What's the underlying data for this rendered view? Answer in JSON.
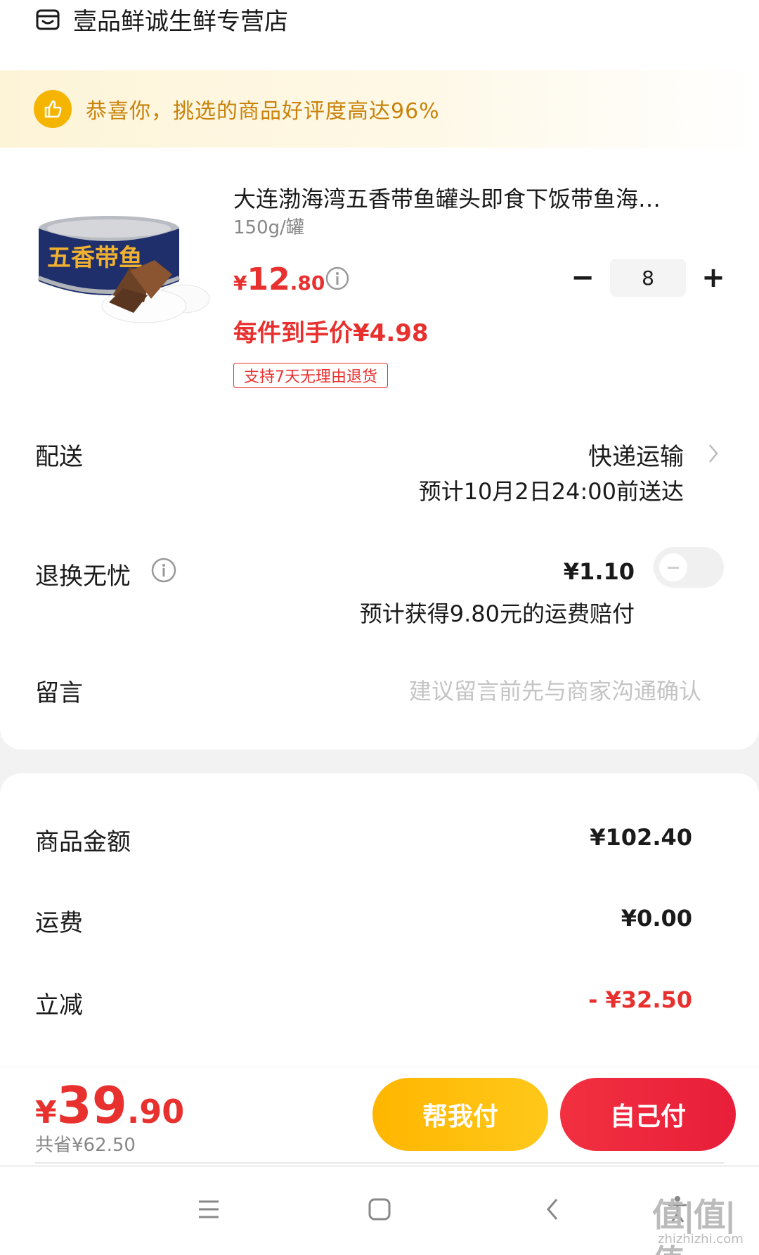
{
  "store": {
    "name": "壹品鲜诚生鲜专营店",
    "icon": "store-icon"
  },
  "banner": {
    "text": "恭喜你，挑选的商品好评度高达96%",
    "icon": "thumbs-up-icon",
    "accent": "#f5b400",
    "text_color": "#c9820a"
  },
  "product": {
    "title": "大连渤海湾五香带鱼罐头即食下饭带鱼海…",
    "spec": "150g/罐",
    "price_yen": "¥",
    "price_int": "12",
    "price_dec": ".80",
    "unit_price": "每件到手价¥4.98",
    "return_tag": "支持7天无理由退货",
    "can_label": "五香带鱼",
    "quantity": "8",
    "minus": "−",
    "plus": "+"
  },
  "delivery": {
    "label": "配送",
    "method": "快递运输",
    "eta": "预计10月2日24:00前送达"
  },
  "return_service": {
    "label": "退换无忧",
    "price": "¥1.10",
    "note": "预计获得9.80元的运费赔付",
    "enabled": false
  },
  "message": {
    "label": "留言",
    "placeholder": "建议留言前先与商家沟通确认"
  },
  "summary": {
    "goods_label": "商品金额",
    "goods_value": "¥102.40",
    "shipping_label": "运费",
    "shipping_value": "¥0.00",
    "discount_label": "立减",
    "discount_value": "- ¥32.50"
  },
  "footer": {
    "total_yen": "¥",
    "total_int": "39",
    "total_dec": ".90",
    "saved": "共省¥62.50",
    "help_pay": "帮我付",
    "self_pay": "自己付"
  },
  "watermark": {
    "main": "值|值|值",
    "sub": "zhizhizhi.com"
  },
  "colors": {
    "red": "#e8312f",
    "yellow": "#ffb600"
  }
}
